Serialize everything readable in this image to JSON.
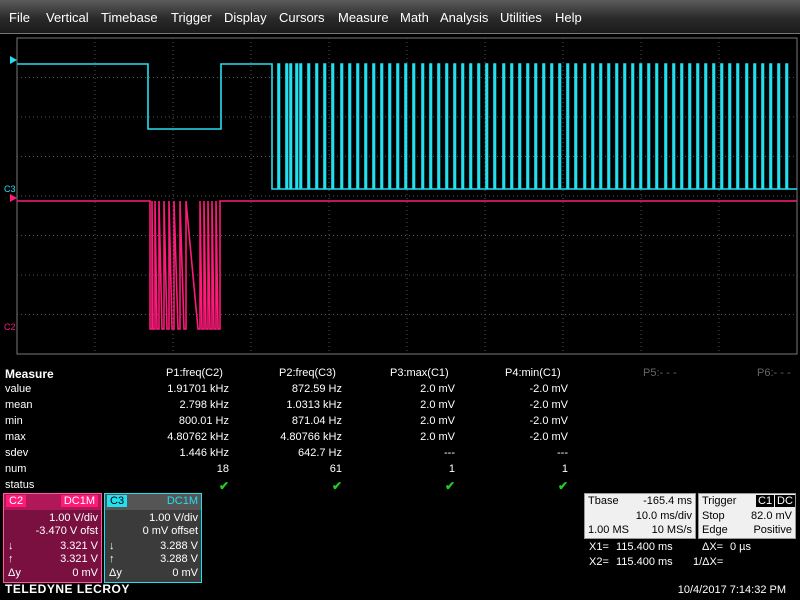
{
  "menu": [
    "File",
    "Vertical",
    "Timebase",
    "Trigger",
    "Display",
    "Cursors",
    "Measure",
    "Math",
    "Analysis",
    "Utilities",
    "Help"
  ],
  "channels": {
    "c3_label": "C3",
    "c2_label": "C2",
    "c3_color": "#22e0f0",
    "c2_color": "#ff1a7a"
  },
  "measure": {
    "title": "Measure",
    "params": [
      "P1:freq(C2)",
      "P2:freq(C3)",
      "P3:max(C1)",
      "P4:min(C1)",
      "P5:- - -",
      "P6:- - -"
    ],
    "row_labels": [
      "value",
      "mean",
      "min",
      "max",
      "sdev",
      "num",
      "status"
    ],
    "rows": [
      [
        "1.91701 kHz",
        "872.59 Hz",
        "2.0 mV",
        "-2.0 mV"
      ],
      [
        "2.798 kHz",
        "1.0313 kHz",
        "2.0 mV",
        "-2.0 mV"
      ],
      [
        "800.01 Hz",
        "871.04 Hz",
        "2.0 mV",
        "-2.0 mV"
      ],
      [
        "4.80762 kHz",
        "4.80766 kHz",
        "2.0 mV",
        "-2.0 mV"
      ],
      [
        "1.446 kHz",
        "642.7 Hz",
        "---",
        "---"
      ],
      [
        "18",
        "61",
        "1",
        "1"
      ]
    ],
    "status_mark": "✔"
  },
  "c2_desc": {
    "name": "C2",
    "coupling": "DC1M",
    "vdiv": "1.00 V/div",
    "offset": "-3.470 V ofst",
    "low_sym": "↓",
    "low": "3.321 V",
    "high_sym": "↑",
    "high": "3.321 V",
    "dy_sym": "Δy",
    "dy": "0 mV"
  },
  "c3_desc": {
    "name": "C3",
    "coupling": "DC1M",
    "vdiv": "1.00 V/div",
    "offset": "0 mV offset",
    "low_sym": "↓",
    "low": "3.288 V",
    "high_sym": "↑",
    "high": "3.288 V",
    "dy_sym": "Δy",
    "dy": "0 mV"
  },
  "timebase": {
    "label": "Tbase",
    "delay": "-165.4 ms",
    "tdiv": "10.0 ms/div",
    "samples": "1.00 MS",
    "rate": "10 MS/s"
  },
  "trigger": {
    "label": "Trigger",
    "src": "C1",
    "coupling": "DC",
    "mode": "Stop",
    "level": "82.0 mV",
    "type": "Edge",
    "slope": "Positive"
  },
  "cursors": {
    "x1_label": "X1=",
    "x1": "115.400 ms",
    "dx_label": "ΔX=",
    "dx": "0 µs",
    "x2_label": "X2=",
    "x2": "115.400 ms",
    "inv_dx_label": "1/ΔX=",
    "inv_dx": ""
  },
  "brand": "TELEDYNE LECROY",
  "datetime": "10/4/2017 7:14:32 PM"
}
